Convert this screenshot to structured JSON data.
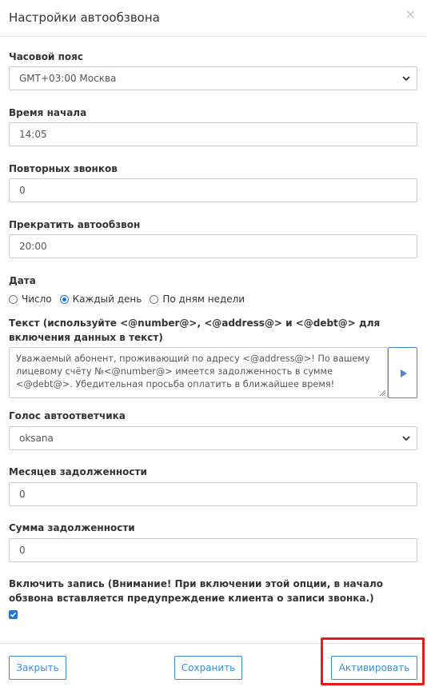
{
  "dialog": {
    "title": "Настройки автообзвона",
    "close_icon": "×"
  },
  "timezone": {
    "label": "Часовой пояс",
    "value": "GMT+03:00 Москва"
  },
  "start_time": {
    "label": "Время начала",
    "value": "14:05"
  },
  "retries": {
    "label": "Повторных звонков",
    "value": "0"
  },
  "stop_time": {
    "label": "Прекратить автообзвон",
    "value": "20:00"
  },
  "date": {
    "label": "Дата",
    "options": [
      {
        "label": "Число",
        "selected": false
      },
      {
        "label": "Каждый день",
        "selected": true
      },
      {
        "label": "По дням недели",
        "selected": false
      }
    ]
  },
  "message": {
    "label": "Текст (используйте <@number@>, <@address@> и <@debt@> для включения данных в текст)",
    "value": "Уважаемый абонент, проживающий по адресу <@address@>!  По вашему лицевому счёту №<@number@> имеется задолженность в сумме <@debt@>. Убедительная просьба оплатить в ближайшее время!",
    "play_icon": "play-icon"
  },
  "voice": {
    "label": "Голос автоответчика",
    "value": "oksana"
  },
  "debt_months": {
    "label": "Месяцев задолженности",
    "value": "0"
  },
  "debt_amount": {
    "label": "Сумма задолженности",
    "value": "0"
  },
  "recording": {
    "label": "Включить запись (Внимание! При включении этой опции, в начало обзвона вставляется предупреждение клиента о записи звонка.)",
    "checked": true
  },
  "footer": {
    "close_label": "Закрыть",
    "save_label": "Сохранить",
    "activate_label": "Активировать"
  },
  "colors": {
    "accent": "#3f8bd6",
    "highlight": "#e31b1b",
    "checkbox": "#1a73e8"
  }
}
